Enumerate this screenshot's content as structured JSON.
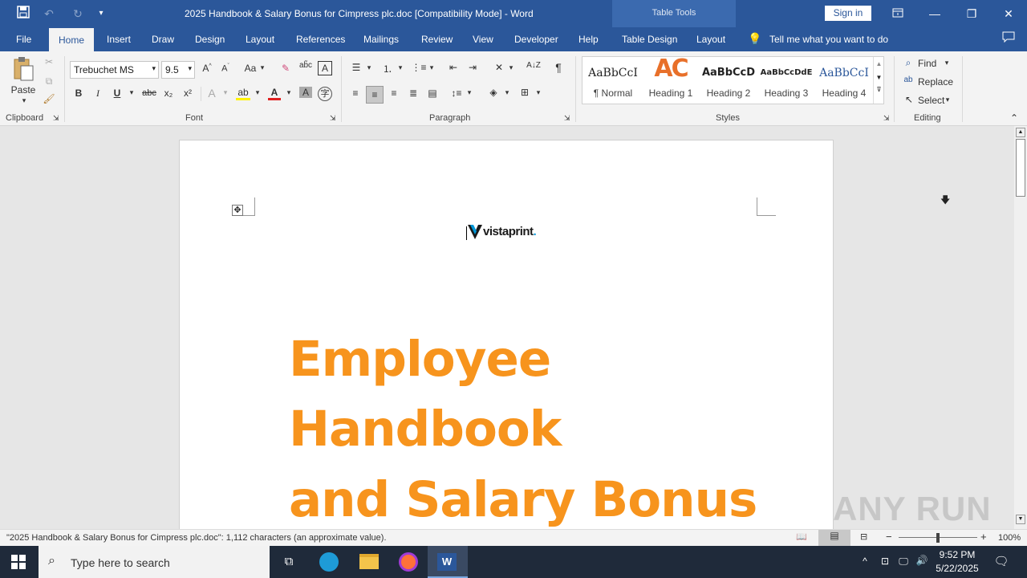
{
  "window": {
    "title": "2025 Handbook & Salary Bonus for Cimpress plc.doc [Compatibility Mode]  -  Word",
    "context_label": "Table Tools",
    "signin_label": "Sign in"
  },
  "tabs": [
    {
      "label": "File"
    },
    {
      "label": "Home"
    },
    {
      "label": "Insert"
    },
    {
      "label": "Draw"
    },
    {
      "label": "Design"
    },
    {
      "label": "Layout"
    },
    {
      "label": "References"
    },
    {
      "label": "Mailings"
    },
    {
      "label": "Review"
    },
    {
      "label": "View"
    },
    {
      "label": "Developer"
    },
    {
      "label": "Help"
    },
    {
      "label": "Table Design"
    },
    {
      "label": "Layout"
    }
  ],
  "tell_me": "Tell me what you want to do",
  "ribbon": {
    "clipboard": {
      "paste": "Paste",
      "label": "Clipboard"
    },
    "font": {
      "family": "Trebuchet MS",
      "size": "9.5",
      "label": "Font",
      "case_btn": "Aa",
      "bold": "B",
      "italic": "I",
      "underline": "U",
      "strike": "abc",
      "sub": "x₂",
      "sup": "x²"
    },
    "paragraph": {
      "label": "Paragraph"
    },
    "styles": {
      "label": "Styles",
      "items": [
        {
          "preview": "AaBbCcI",
          "name": "¶ Normal"
        },
        {
          "preview": "AC",
          "name": "Heading 1"
        },
        {
          "preview": "AaBbCcD",
          "name": "Heading 2"
        },
        {
          "preview": "AaBbCcDdE",
          "name": "Heading 3"
        },
        {
          "preview": "AaBbCcI",
          "name": "Heading 4"
        }
      ]
    },
    "editing": {
      "find": "Find",
      "replace": "Replace",
      "select": "Select",
      "label": "Editing"
    }
  },
  "document": {
    "logo_text": "vistaprint",
    "logo_dot": ".",
    "lines": [
      "Employee",
      "Handbook",
      "and Salary Bonus"
    ],
    "heading_color": "#f7941d"
  },
  "status": {
    "text": "\"2025 Handbook & Salary Bonus for Cimpress plc.doc\": 1,112 characters (an approximate value).",
    "zoom": "100%",
    "zoom_fraction": 0.5
  },
  "taskbar": {
    "search_placeholder": "Type here to search",
    "time": "9:52 PM",
    "date": "5/22/2025"
  },
  "watermark": "ANY RUN",
  "colors": {
    "accent": "#2b579a",
    "heading": "#f7941d"
  }
}
